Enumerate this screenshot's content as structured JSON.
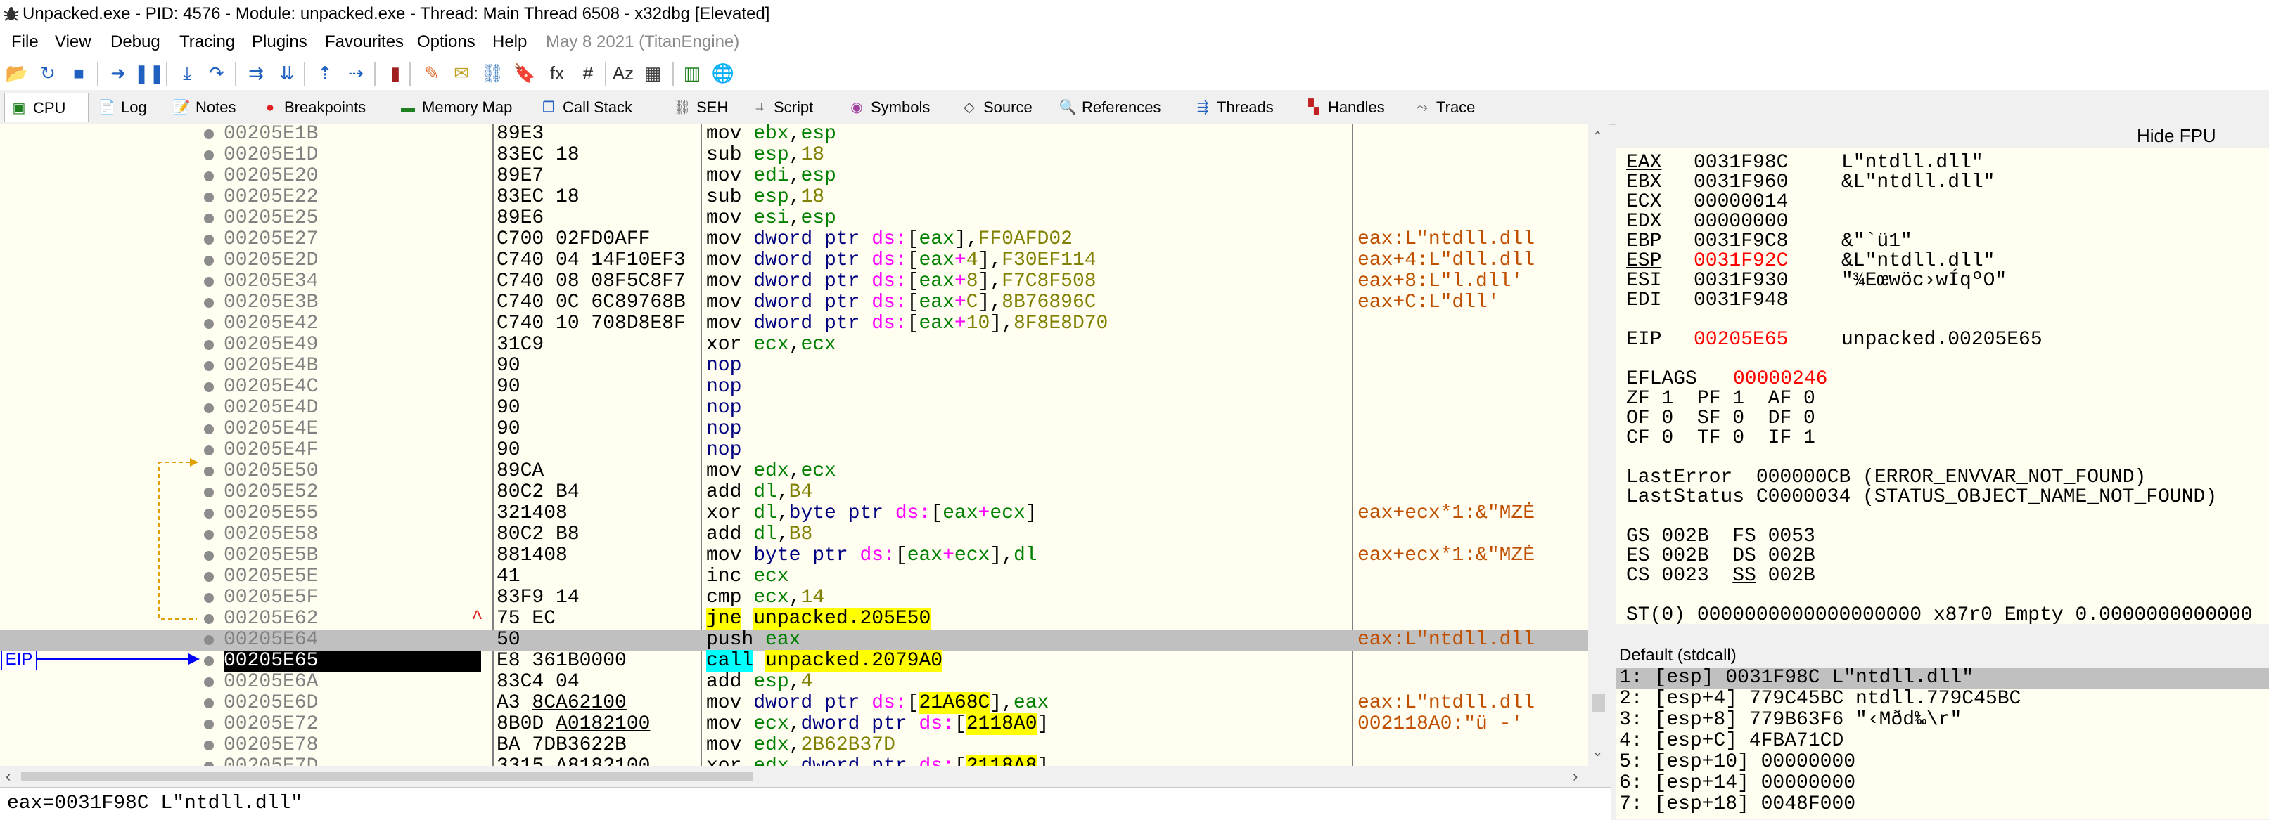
{
  "window": {
    "title": "Unpacked.exe - PID: 4576 - Module: unpacked.exe - Thread: Main Thread 6508 - x32dbg [Elevated]"
  },
  "menu": {
    "items": [
      "File",
      "View",
      "Debug",
      "Tracing",
      "Plugins",
      "Favourites",
      "Options",
      "Help"
    ],
    "date": "May 8 2021 (TitanEngine)"
  },
  "toolbar": {
    "icons": [
      {
        "icon": "open-folder-icon",
        "glyph": "📂",
        "color": "#e0a020"
      },
      {
        "icon": "restart-icon",
        "glyph": "↻",
        "color": "#2060c0"
      },
      {
        "icon": "close-icon",
        "glyph": "■",
        "color": "#2060c0"
      },
      {
        "icon": "run-icon",
        "glyph": "➜",
        "color": "#2060c0"
      },
      {
        "icon": "pause-icon",
        "glyph": "❚❚",
        "color": "#2060c0"
      },
      {
        "icon": "step-into-icon",
        "glyph": "⤓",
        "color": "#2060c0"
      },
      {
        "icon": "step-over-icon",
        "glyph": "↷",
        "color": "#2060c0"
      },
      {
        "icon": "trace-into-icon",
        "glyph": "⇉",
        "color": "#2060c0"
      },
      {
        "icon": "trace-over-icon",
        "glyph": "⇊",
        "color": "#2060c0"
      },
      {
        "icon": "execute-till-return-icon",
        "glyph": "⇡",
        "color": "#2060c0"
      },
      {
        "icon": "run-to-user-code-icon",
        "glyph": "⇢",
        "color": "#2060c0"
      },
      {
        "icon": "scylla-icon",
        "glyph": "▮",
        "color": "#a02020"
      },
      {
        "icon": "patch-icon",
        "glyph": "✎",
        "color": "#e07030"
      },
      {
        "icon": "comments-icon",
        "glyph": "✉",
        "color": "#c0a020"
      },
      {
        "icon": "labels-icon",
        "glyph": "⛓",
        "color": "#4080c0"
      },
      {
        "icon": "bookmarks-icon",
        "glyph": "🔖",
        "color": "#e03030"
      },
      {
        "icon": "functions-icon",
        "glyph": "fx",
        "color": "#303030"
      },
      {
        "icon": "variables-icon",
        "glyph": "#",
        "color": "#303030"
      },
      {
        "icon": "strings-icon",
        "glyph": "Az",
        "color": "#303030"
      },
      {
        "icon": "calculator-icon",
        "glyph": "▦",
        "color": "#404040"
      },
      {
        "icon": "cheat-sheet-icon",
        "glyph": "▥",
        "color": "#208020"
      },
      {
        "icon": "globe-icon",
        "glyph": "🌐",
        "color": "#2080c0"
      }
    ]
  },
  "tabs": [
    {
      "label": "CPU",
      "icon": "cpu-icon",
      "glyph": "▣",
      "color": "#208020",
      "active": true
    },
    {
      "label": "Log",
      "icon": "log-icon",
      "glyph": "📄",
      "color": "#606060"
    },
    {
      "label": "Notes",
      "icon": "notes-icon",
      "glyph": "📝",
      "color": "#606060"
    },
    {
      "label": "Breakpoints",
      "icon": "breakpoints-icon",
      "glyph": "●",
      "color": "#e02020"
    },
    {
      "label": "Memory Map",
      "icon": "memory-map-icon",
      "glyph": "▬",
      "color": "#208020"
    },
    {
      "label": "Call Stack",
      "icon": "call-stack-icon",
      "glyph": "❐",
      "color": "#2060c0"
    },
    {
      "label": "SEH",
      "icon": "seh-icon",
      "glyph": "⛓",
      "color": "#606060"
    },
    {
      "label": "Script",
      "icon": "script-icon",
      "glyph": "⌗",
      "color": "#606060"
    },
    {
      "label": "Symbols",
      "icon": "symbols-icon",
      "glyph": "◉",
      "color": "#a040a0"
    },
    {
      "label": "Source",
      "icon": "source-icon",
      "glyph": "◇",
      "color": "#404040"
    },
    {
      "label": "References",
      "icon": "references-icon",
      "glyph": "🔍",
      "color": "#606060"
    },
    {
      "label": "Threads",
      "icon": "threads-icon",
      "glyph": "⇶",
      "color": "#2060c0"
    },
    {
      "label": "Handles",
      "icon": "handles-icon",
      "glyph": "▚",
      "color": "#c02020"
    },
    {
      "label": "Trace",
      "icon": "trace-icon",
      "glyph": "⤳",
      "color": "#606060"
    }
  ],
  "disasm": {
    "eip_label": "EIP",
    "jump_arrow_glyph": "^",
    "rows": [
      {
        "addr": "00205E1B",
        "bytes": "89E3",
        "instr": [
          [
            "mov ",
            "mn"
          ],
          [
            "ebx",
            "reg"
          ],
          [
            ",",
            "p"
          ],
          [
            "esp",
            "reg"
          ]
        ],
        "cmt": ""
      },
      {
        "addr": "00205E1D",
        "bytes": "83EC 18",
        "instr": [
          [
            "sub ",
            "mn"
          ],
          [
            "esp",
            "reg"
          ],
          [
            ",",
            "p"
          ],
          [
            "18",
            "imm"
          ]
        ],
        "cmt": ""
      },
      {
        "addr": "00205E20",
        "bytes": "89E7",
        "instr": [
          [
            "mov ",
            "mn"
          ],
          [
            "edi",
            "reg"
          ],
          [
            ",",
            "p"
          ],
          [
            "esp",
            "reg"
          ]
        ],
        "cmt": ""
      },
      {
        "addr": "00205E22",
        "bytes": "83EC 18",
        "instr": [
          [
            "sub ",
            "mn"
          ],
          [
            "esp",
            "reg"
          ],
          [
            ",",
            "p"
          ],
          [
            "18",
            "imm"
          ]
        ],
        "cmt": ""
      },
      {
        "addr": "00205E25",
        "bytes": "89E6",
        "instr": [
          [
            "mov ",
            "mn"
          ],
          [
            "esi",
            "reg"
          ],
          [
            ",",
            "p"
          ],
          [
            "esp",
            "reg"
          ]
        ],
        "cmt": ""
      },
      {
        "addr": "00205E27",
        "bytes": "C700 02FD0AFF",
        "instr": [
          [
            "mov ",
            "mn"
          ],
          [
            "dword ptr ",
            "ptr"
          ],
          [
            "ds:",
            "seg"
          ],
          [
            "[",
            "p"
          ],
          [
            "eax",
            "reg"
          ],
          [
            "],",
            "p"
          ],
          [
            "FF0AFD02",
            "imm"
          ]
        ],
        "cmt": "eax:L\"ntdll.dll"
      },
      {
        "addr": "00205E2D",
        "bytes": "C740 04 14F10EF3",
        "instr": [
          [
            "mov ",
            "mn"
          ],
          [
            "dword ptr ",
            "ptr"
          ],
          [
            "ds:",
            "seg"
          ],
          [
            "[",
            "p"
          ],
          [
            "eax",
            "reg"
          ],
          [
            "+",
            "seg"
          ],
          [
            "4",
            "imm"
          ],
          [
            "],",
            "p"
          ],
          [
            "F30EF114",
            "imm"
          ]
        ],
        "cmt": "eax+4:L\"dll.dll"
      },
      {
        "addr": "00205E34",
        "bytes": "C740 08 08F5C8F7",
        "instr": [
          [
            "mov ",
            "mn"
          ],
          [
            "dword ptr ",
            "ptr"
          ],
          [
            "ds:",
            "seg"
          ],
          [
            "[",
            "p"
          ],
          [
            "eax",
            "reg"
          ],
          [
            "+",
            "seg"
          ],
          [
            "8",
            "imm"
          ],
          [
            "],",
            "p"
          ],
          [
            "F7C8F508",
            "imm"
          ]
        ],
        "cmt": "eax+8:L\"l.dll'"
      },
      {
        "addr": "00205E3B",
        "bytes": "C740 0C 6C89768B",
        "instr": [
          [
            "mov ",
            "mn"
          ],
          [
            "dword ptr ",
            "ptr"
          ],
          [
            "ds:",
            "seg"
          ],
          [
            "[",
            "p"
          ],
          [
            "eax",
            "reg"
          ],
          [
            "+",
            "seg"
          ],
          [
            "C",
            "imm"
          ],
          [
            "],",
            "p"
          ],
          [
            "8B76896C",
            "imm"
          ]
        ],
        "cmt": "eax+C:L\"dll'"
      },
      {
        "addr": "00205E42",
        "bytes": "C740 10 708D8E8F",
        "instr": [
          [
            "mov ",
            "mn"
          ],
          [
            "dword ptr ",
            "ptr"
          ],
          [
            "ds:",
            "seg"
          ],
          [
            "[",
            "p"
          ],
          [
            "eax",
            "reg"
          ],
          [
            "+",
            "seg"
          ],
          [
            "10",
            "imm"
          ],
          [
            "],",
            "p"
          ],
          [
            "8F8E8D70",
            "imm"
          ]
        ],
        "cmt": ""
      },
      {
        "addr": "00205E49",
        "bytes": "31C9",
        "instr": [
          [
            "xor ",
            "mn"
          ],
          [
            "ecx",
            "reg"
          ],
          [
            ",",
            "p"
          ],
          [
            "ecx",
            "reg"
          ]
        ],
        "cmt": ""
      },
      {
        "addr": "00205E4B",
        "bytes": "90",
        "instr": [
          [
            "nop",
            "nopc"
          ]
        ],
        "cmt": ""
      },
      {
        "addr": "00205E4C",
        "bytes": "90",
        "instr": [
          [
            "nop",
            "nopc"
          ]
        ],
        "cmt": ""
      },
      {
        "addr": "00205E4D",
        "bytes": "90",
        "instr": [
          [
            "nop",
            "nopc"
          ]
        ],
        "cmt": ""
      },
      {
        "addr": "00205E4E",
        "bytes": "90",
        "instr": [
          [
            "nop",
            "nopc"
          ]
        ],
        "cmt": ""
      },
      {
        "addr": "00205E4F",
        "bytes": "90",
        "instr": [
          [
            "nop",
            "nopc"
          ]
        ],
        "cmt": ""
      },
      {
        "addr": "00205E50",
        "bytes": "89CA",
        "instr": [
          [
            "mov ",
            "mn"
          ],
          [
            "edx",
            "reg"
          ],
          [
            ",",
            "p"
          ],
          [
            "ecx",
            "reg"
          ]
        ],
        "cmt": ""
      },
      {
        "addr": "00205E52",
        "bytes": "80C2 B4",
        "instr": [
          [
            "add ",
            "mn"
          ],
          [
            "dl",
            "reg"
          ],
          [
            ",",
            "p"
          ],
          [
            "B4",
            "imm"
          ]
        ],
        "cmt": ""
      },
      {
        "addr": "00205E55",
        "bytes": "321408",
        "instr": [
          [
            "xor ",
            "mn"
          ],
          [
            "dl",
            "reg"
          ],
          [
            ",",
            "p"
          ],
          [
            "byte ptr ",
            "ptr"
          ],
          [
            "ds:",
            "seg"
          ],
          [
            "[",
            "p"
          ],
          [
            "eax",
            "reg"
          ],
          [
            "+",
            "seg"
          ],
          [
            "ecx",
            "reg"
          ],
          [
            "]",
            "p"
          ]
        ],
        "cmt": "eax+ecx*1:&\"MZĖ"
      },
      {
        "addr": "00205E58",
        "bytes": "80C2 B8",
        "instr": [
          [
            "add ",
            "mn"
          ],
          [
            "dl",
            "reg"
          ],
          [
            ",",
            "p"
          ],
          [
            "B8",
            "imm"
          ]
        ],
        "cmt": ""
      },
      {
        "addr": "00205E5B",
        "bytes": "881408",
        "instr": [
          [
            "mov ",
            "mn"
          ],
          [
            "byte ptr ",
            "ptr"
          ],
          [
            "ds:",
            "seg"
          ],
          [
            "[",
            "p"
          ],
          [
            "eax",
            "reg"
          ],
          [
            "+",
            "seg"
          ],
          [
            "ecx",
            "reg"
          ],
          [
            "],",
            "p"
          ],
          [
            "dl",
            "reg"
          ]
        ],
        "cmt": "eax+ecx*1:&\"MZĖ"
      },
      {
        "addr": "00205E5E",
        "bytes": "41",
        "instr": [
          [
            "inc ",
            "mn"
          ],
          [
            "ecx",
            "reg"
          ]
        ],
        "cmt": ""
      },
      {
        "addr": "00205E5F",
        "bytes": "83F9 14",
        "instr": [
          [
            "cmp ",
            "mn"
          ],
          [
            "ecx",
            "reg"
          ],
          [
            ",",
            "p"
          ],
          [
            "14",
            "imm"
          ]
        ],
        "cmt": ""
      },
      {
        "addr": "00205E62",
        "bytes": "75 EC",
        "instr": [
          [
            "jne",
            "jmp"
          ],
          [
            " ",
            "p"
          ],
          [
            "unpacked.205E50",
            "tgt"
          ]
        ],
        "cmt": "",
        "jump": true
      },
      {
        "addr": "00205E64",
        "bytes": "50",
        "instr": [
          [
            "push ",
            "mn"
          ],
          [
            "eax",
            "reg"
          ]
        ],
        "cmt": "eax:L\"ntdll.dll",
        "hl": true
      },
      {
        "addr": "00205E65",
        "bytes": "E8 361B0000",
        "instr": [
          [
            "call",
            "call"
          ],
          [
            " ",
            "p"
          ],
          [
            "unpacked.2079A0",
            "tgt"
          ]
        ],
        "cmt": "",
        "cur": true
      },
      {
        "addr": "00205E6A",
        "bytes": "83C4 04",
        "instr": [
          [
            "add ",
            "mn"
          ],
          [
            "esp",
            "reg"
          ],
          [
            ",",
            "p"
          ],
          [
            "4",
            "imm"
          ]
        ],
        "cmt": ""
      },
      {
        "addr": "00205E6D",
        "bytes": "A3 8CA62100",
        "bytes_ul": true,
        "instr": [
          [
            "mov ",
            "mn"
          ],
          [
            "dword ptr ",
            "ptr"
          ],
          [
            "ds:",
            "seg"
          ],
          [
            "[",
            "p"
          ],
          [
            "21A68C",
            "tgt"
          ],
          [
            "],",
            "p"
          ],
          [
            "eax",
            "reg"
          ]
        ],
        "cmt": "eax:L\"ntdll.dll"
      },
      {
        "addr": "00205E72",
        "bytes": "8B0D A0182100",
        "bytes_ul": true,
        "instr": [
          [
            "mov ",
            "mn"
          ],
          [
            "ecx",
            "reg"
          ],
          [
            ",",
            "p"
          ],
          [
            "dword ptr ",
            "ptr"
          ],
          [
            "ds:",
            "seg"
          ],
          [
            "[",
            "p"
          ],
          [
            "2118A0",
            "tgt"
          ],
          [
            "]",
            "p"
          ]
        ],
        "cmt": "002118A0:\"ü -'"
      },
      {
        "addr": "00205E78",
        "bytes": "BA 7DB3622B",
        "instr": [
          [
            "mov ",
            "mn"
          ],
          [
            "edx",
            "reg"
          ],
          [
            ",",
            "p"
          ],
          [
            "2B62B37D",
            "imm"
          ]
        ],
        "cmt": ""
      },
      {
        "addr": "00205E7D",
        "bytes": "3315 A8182100",
        "bytes_ul": true,
        "instr": [
          [
            "xor ",
            "mn"
          ],
          [
            "edx",
            "reg"
          ],
          [
            ",",
            "p"
          ],
          [
            "dword ptr ",
            "ptr"
          ],
          [
            "ds:",
            "seg"
          ],
          [
            "[",
            "p"
          ],
          [
            "2118A8",
            "tgt"
          ],
          [
            "]",
            "p"
          ]
        ],
        "cmt": ""
      }
    ]
  },
  "registers": {
    "hide_fpu_label": "Hide FPU",
    "rows": [
      {
        "name": "EAX",
        "value": "0031F98C",
        "comment": "L\"ntdll.dll\"",
        "name_ul": true
      },
      {
        "name": "EBX",
        "value": "0031F960",
        "comment": "&L\"ntdll.dll\""
      },
      {
        "name": "ECX",
        "value": "00000014",
        "comment": ""
      },
      {
        "name": "EDX",
        "value": "00000000",
        "comment": ""
      },
      {
        "name": "EBP",
        "value": "0031F9C8",
        "comment": "&\"`ü1\""
      },
      {
        "name": "ESP",
        "value": "0031F92C",
        "comment": "&L\"ntdll.dll\"",
        "name_ul": true,
        "value_red": true
      },
      {
        "name": "ESI",
        "value": "0031F930",
        "comment": "\"¾Eœwöc›wÍqºO\""
      },
      {
        "name": "EDI",
        "value": "0031F948",
        "comment": ""
      }
    ],
    "eip": {
      "name": "EIP",
      "value": "00205E65",
      "comment": "unpacked.00205E65"
    },
    "eflags": {
      "name": "EFLAGS",
      "value": "00000246"
    },
    "flags": [
      "ZF 1  PF 1  AF 0",
      "OF 0  SF 0  DF 0",
      "CF 0  TF 0  IF 1"
    ],
    "last_error": "LastError  000000CB (ERROR_ENVVAR_NOT_FOUND)",
    "last_status": "LastStatus C0000034 (STATUS_OBJECT_NAME_NOT_FOUND)",
    "segments": [
      [
        {
          "t": "GS 002B  FS 0053"
        }
      ],
      [
        {
          "t": "ES 002B  DS 002B"
        }
      ],
      [
        {
          "t": "CS 0023  "
        },
        {
          "t": "SS",
          "ul": true
        },
        {
          "t": " 002B"
        }
      ]
    ],
    "fpu_line": "ST(0) 0000000000000000000 x87r0 Empty 0.0000000000000"
  },
  "stack": {
    "header": "Default (stdcall)",
    "rows": [
      "1: [esp] 0031F98C L\"ntdll.dll\"",
      "2: [esp+4] 779C45BC ntdll.779C45BC",
      "3: [esp+8] 779B63F6 \"‹Mðd‰\\r\"",
      "4: [esp+C] 4FBA71CD",
      "5: [esp+10] 00000000",
      "6: [esp+14] 00000000",
      "7: [esp+18] 0048F000"
    ]
  },
  "status": {
    "text": "eax=0031F98C L\"ntdll.dll\""
  },
  "colors": {
    "disasm_bg": "#fffef0",
    "highlight_row": "#c0c0c0",
    "eip_arrow": "#0000ff",
    "jump_line": "#e0a000",
    "register_changed": "#ff0000"
  }
}
